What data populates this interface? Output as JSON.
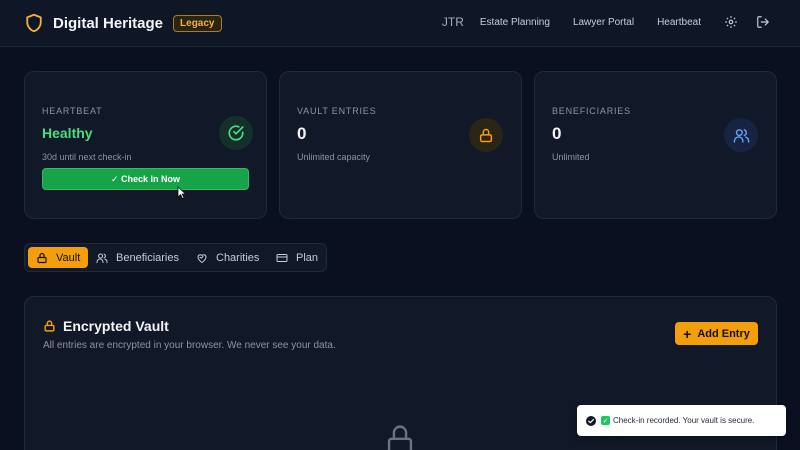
{
  "header": {
    "brand": "Digital Heritage",
    "badge": "Legacy",
    "user": "JTR",
    "nav": [
      "Estate Planning",
      "Lawyer Portal",
      "Heartbeat"
    ]
  },
  "cards": {
    "heartbeat": {
      "label": "HEARTBEAT",
      "status": "Healthy",
      "sub": "30d until next check-in",
      "button": "✓ Check In Now"
    },
    "vault": {
      "label": "VAULT ENTRIES",
      "value": "0",
      "sub": "Unlimited capacity"
    },
    "beneficiaries": {
      "label": "BENEFICIARIES",
      "value": "0",
      "sub": "Unlimited"
    }
  },
  "tabs": [
    "Vault",
    "Beneficiaries",
    "Charities",
    "Plan"
  ],
  "vault": {
    "title": "Encrypted Vault",
    "description": "All entries are encrypted in your browser. We never see your data.",
    "add_label": "Add Entry"
  },
  "toast": {
    "emoji": "✓",
    "message": "Check-in recorded. Your vault is secure."
  },
  "colors": {
    "accent": "#f59e0b",
    "success": "#16a34a",
    "background": "#0b1020"
  }
}
